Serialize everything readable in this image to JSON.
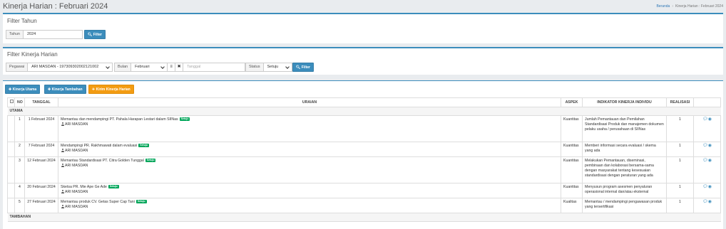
{
  "header": {
    "title": "Kinerja Harian : Februari 2024",
    "breadcrumb": [
      "Beranda",
      "Kinerja Harian : Februari 2024"
    ]
  },
  "filter_tahun": {
    "title": "Filter Tahun",
    "label": "Tahun",
    "value": "2024",
    "button": "Filter"
  },
  "filter_kinerja": {
    "title": "Filter Kinerja Harian",
    "pegawai_label": "Pegawai",
    "pegawai_value": "ARI MASDAN - 197309302002121002",
    "bulan_label": "Bulan",
    "bulan_value": "Februari",
    "tanggal_placeholder": "Tanggal",
    "status_label": "Status",
    "status_value": "Setuju",
    "button": "Filter"
  },
  "actions": {
    "kinerja_utama": "Kinerja Utama",
    "kinerja_tambahan": "Kinerja Tambahan",
    "kirim": "Kirim Kinerja Harian"
  },
  "table": {
    "headers": [
      "",
      "NO",
      "TANGGAL",
      "URAIAN",
      "ASPEK",
      "INDIKATOR KINERJA INDIVIDU",
      "REALISASI",
      ""
    ],
    "groups": {
      "utama": "UTAMA",
      "tambahan": "TAMBAHAN"
    },
    "badge": "Setuju",
    "rows": [
      {
        "no": "1",
        "tanggal": "1 Februari 2024",
        "uraian": "Memantau dan mendampingi PT. Pahala Harapan Lestari dalam SIINas",
        "pegawai": "ARI MASDAN",
        "aspek": "Kuantitas",
        "indikator": "Jumlah Pemantauan dan Pemilahan Standardisasi Produk dan manajemen dokumen pelaku usaha / perusahaan di SIINas",
        "realisasi": "1"
      },
      {
        "no": "2",
        "tanggal": "7 Februari 2024",
        "uraian": "Mendampingi PR. Rakhmawati dalam evaluasi",
        "pegawai": "ARI MASDAN",
        "aspek": "Kuantitas",
        "indikator": "Memberi informasi secara evaluasi / skema yang ada",
        "realisasi": "1"
      },
      {
        "no": "3",
        "tanggal": "12 Februari 2024",
        "uraian": "Memantau Standardisasi PT. Citra Golden Tunggal",
        "pegawai": "ARI MASDAN",
        "aspek": "Kuantitas",
        "indikator": "Melakukan Pemantauan, diseminasi, pembinaan dan kolaborasi bersama-sama dengan masyarakat tentang kesesuaian standardisasi dengan peraturan yang ada",
        "realisasi": "1"
      },
      {
        "no": "4",
        "tanggal": "20 Februari 2024",
        "uraian": "Sketsa PR. Mie Ape Ge Ade",
        "pegawai": "ARI MASDAN",
        "aspek": "Kuantitas",
        "indikator": "Menyusun program asesmen penyaluran operasional internal dan/atau eksternal",
        "realisasi": "1"
      },
      {
        "no": "5",
        "tanggal": "27 Februari 2024",
        "uraian": "Memantau produk CV. Getas Super Cap Tani",
        "pegawai": "ARI MASDAN",
        "aspek": "Kualitas",
        "indikator": "Memantau / mendampingi pengawasan produk yang tersertifikasi",
        "realisasi": "1"
      }
    ]
  }
}
